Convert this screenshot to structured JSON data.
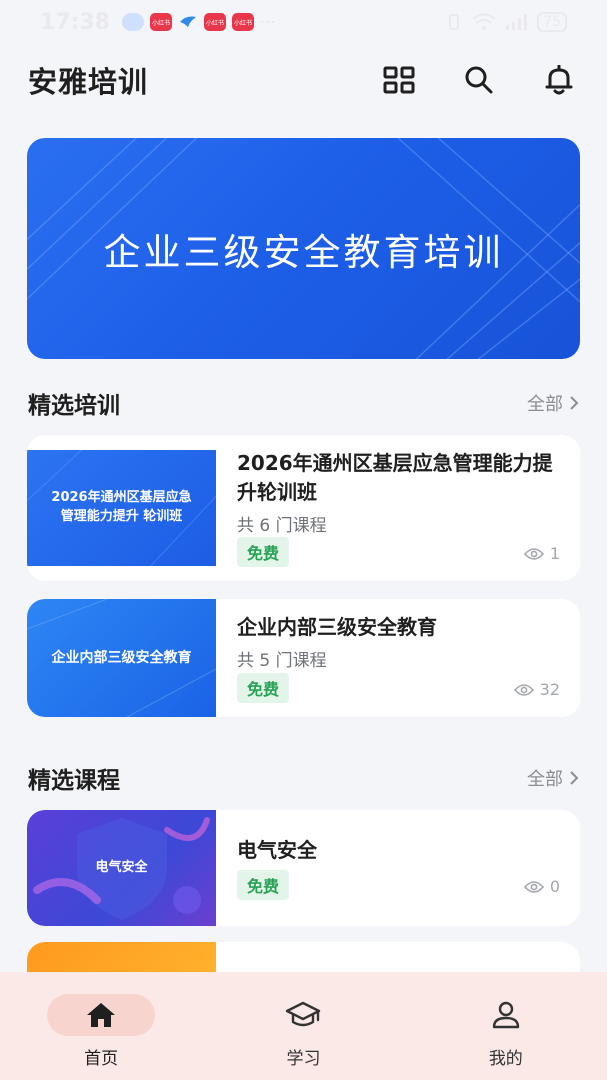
{
  "status_bar": {
    "time": "17:38",
    "app_badges": [
      "小红书",
      "小红书",
      "小红书"
    ],
    "dots": "···",
    "battery": "75"
  },
  "header": {
    "title": "安雅培训"
  },
  "banner": {
    "text": "企业三级安全教育培训"
  },
  "featured_training": {
    "title": "精选培训",
    "more_label": "全部",
    "items": [
      {
        "thumb_text": "2026年通州区基层应急管理能力提升 轮训班",
        "title": "2026年通州区基层应急管理能力提升轮训班",
        "subtitle": "共 6 门课程",
        "tag": "免费",
        "views": "1"
      },
      {
        "thumb_text": "企业内部三级安全教育",
        "title": "企业内部三级安全教育",
        "subtitle": "共 5 门课程",
        "tag": "免费",
        "views": "32"
      }
    ]
  },
  "featured_courses": {
    "title": "精选课程",
    "more_label": "全部",
    "items": [
      {
        "thumb_text": "电气安全",
        "title": "电气安全",
        "tag": "免费",
        "views": "0"
      }
    ]
  },
  "tabbar": {
    "tabs": [
      {
        "label": "首页",
        "icon": "home-icon",
        "active": true
      },
      {
        "label": "学习",
        "icon": "graduation-cap-icon",
        "active": false
      },
      {
        "label": "我的",
        "icon": "user-icon",
        "active": false
      }
    ]
  },
  "colors": {
    "accent_blue": "#1e5fe8",
    "free_tag_bg": "#e3f5e9",
    "free_tag_text": "#2aa255",
    "tabbar_bg": "#fbe9e7",
    "tab_active_pill": "#f8d4cf"
  }
}
